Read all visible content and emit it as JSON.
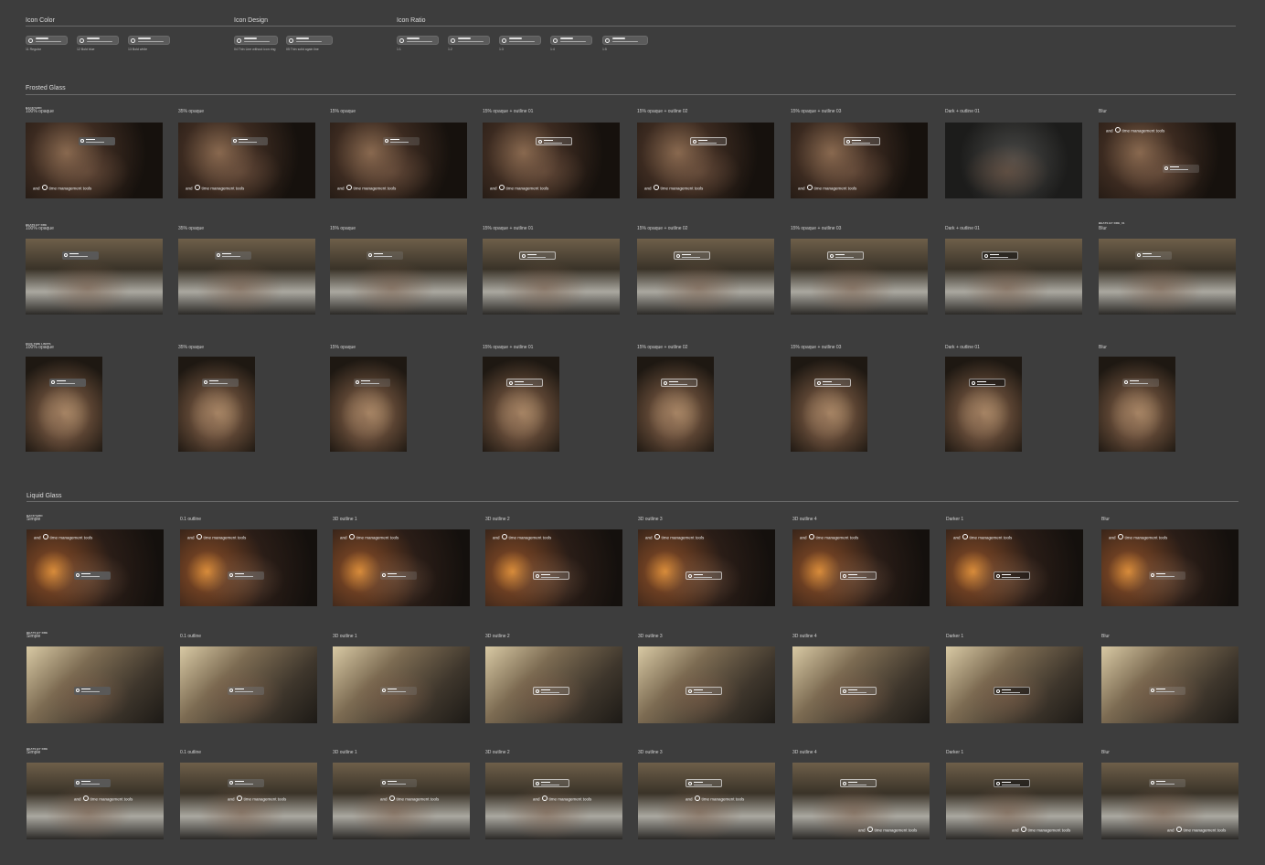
{
  "sections_top": [
    {
      "title": "Icon Color",
      "chips": [
        "11 Regular",
        "12 Bold blue",
        "13 Bold white"
      ]
    },
    {
      "title": "Icon Design",
      "chips": [
        "04 Thin Line without icon ring",
        "05 Thin solid again line"
      ]
    },
    {
      "title": "Icon Ratio",
      "chips": [
        "1:1",
        "1:2",
        "1:3",
        "1:4",
        "1:5"
      ]
    }
  ],
  "frosted": {
    "title": "Frosted Glass",
    "rows": [
      {
        "tag": "BACKYARD",
        "tag_last": "",
        "labels": [
          "100% opaque",
          "35% opaque",
          "15% opaque",
          "15% opaque + outline 01",
          "15% opaque + outline 02",
          "15% opaque + outline 03",
          "Dark + outline 01",
          "Blur"
        ]
      },
      {
        "tag": "BEATS BY DRE",
        "tag_last": "BEATS BY DRE_01",
        "labels": [
          "100% opaque",
          "35% opaque",
          "15% opaque",
          "15% opaque + outline 01",
          "15% opaque + outline 02",
          "15% opaque + outline 03",
          "Dark + outline 01",
          "Blur"
        ]
      },
      {
        "tag": "KICK TIME LIMITS",
        "tag_last": "",
        "labels": [
          "100% opaque",
          "35% opaque",
          "15% opaque",
          "15% opaque + outline 01",
          "15% opaque + outline 02",
          "15% opaque + outline 03",
          "Dark + outline 01",
          "Blur"
        ]
      }
    ]
  },
  "liquid": {
    "title": "Liquid Glass",
    "rows": [
      {
        "tag": "BACKYARD",
        "labels": [
          "Simple",
          "0.1 outline",
          "3D outline 1",
          "3D outline 2",
          "3D outline 3",
          "3D outline 4",
          "Darker 1",
          "Blur"
        ]
      },
      {
        "tag": "BEATS BY DRE",
        "labels": [
          "Simple",
          "0.1 outline",
          "3D outline 1",
          "3D outline 2",
          "3D outline 3",
          "3D outline 4",
          "Darker 1",
          "Blur"
        ]
      },
      {
        "tag": "BEATS BY DRE",
        "labels": [
          "Simple",
          "0.1 outline",
          "3D outline 1",
          "3D outline 2",
          "3D outline 3",
          "3D outline 4",
          "Darker 1",
          "Blur"
        ]
      }
    ]
  },
  "overlay": {
    "prefix": "and",
    "text": "time management tools"
  },
  "icons": {
    "chip_icon": "clock-icon"
  },
  "colors": {
    "canvas": "#3d3d3d",
    "rule": "#6a6a6a",
    "chip": "#5b5b5b"
  }
}
